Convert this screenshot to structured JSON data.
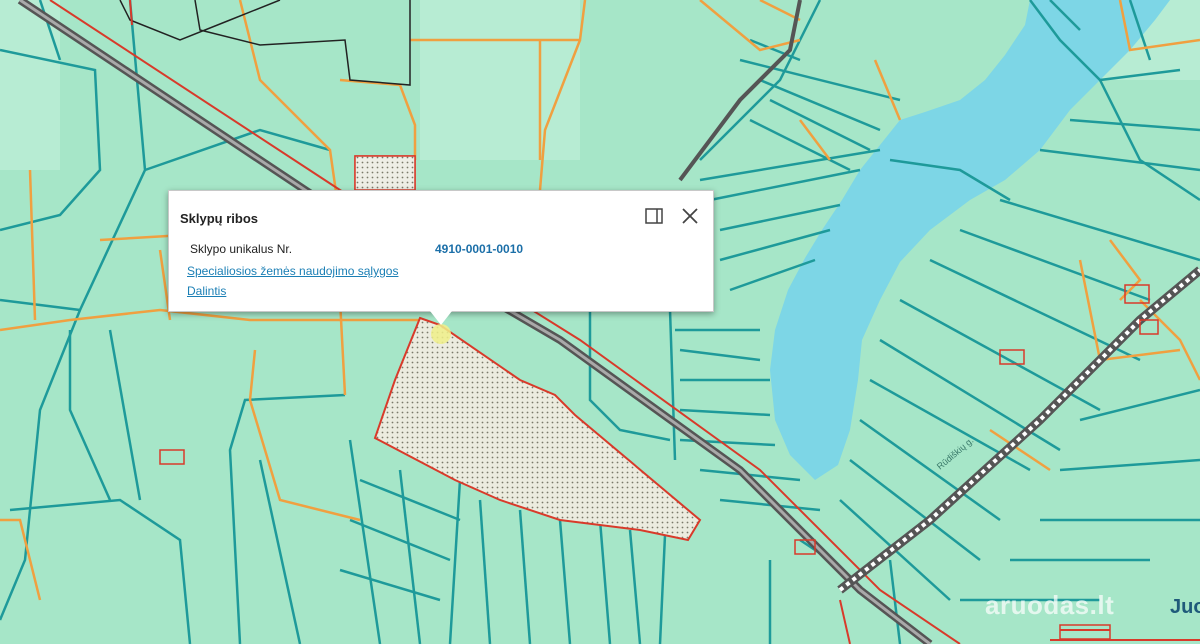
{
  "map": {
    "colors": {
      "land": "#a6e6c8",
      "lake": "#7dd6e6",
      "parcel_line": "#1e9a9a",
      "orange_line": "#f0a040",
      "red_line": "#d83a2a",
      "railway": "#555555",
      "selected_fill": "#e8e8e0"
    },
    "labels": {
      "road_label": "Rūdiškių g."
    }
  },
  "popup": {
    "title": "Sklypų ribos",
    "parcel_label": "Sklypo unikalus Nr.",
    "parcel_value": "4910-0001-0010",
    "link_special": "Specialiosios žemės naudojimo sąlygos",
    "link_share": "Dalintis",
    "icons": {
      "dock": "dock-panel-icon",
      "close": "close-icon"
    }
  },
  "watermark": {
    "text": "aruodas.lt",
    "tail": "Juo"
  }
}
